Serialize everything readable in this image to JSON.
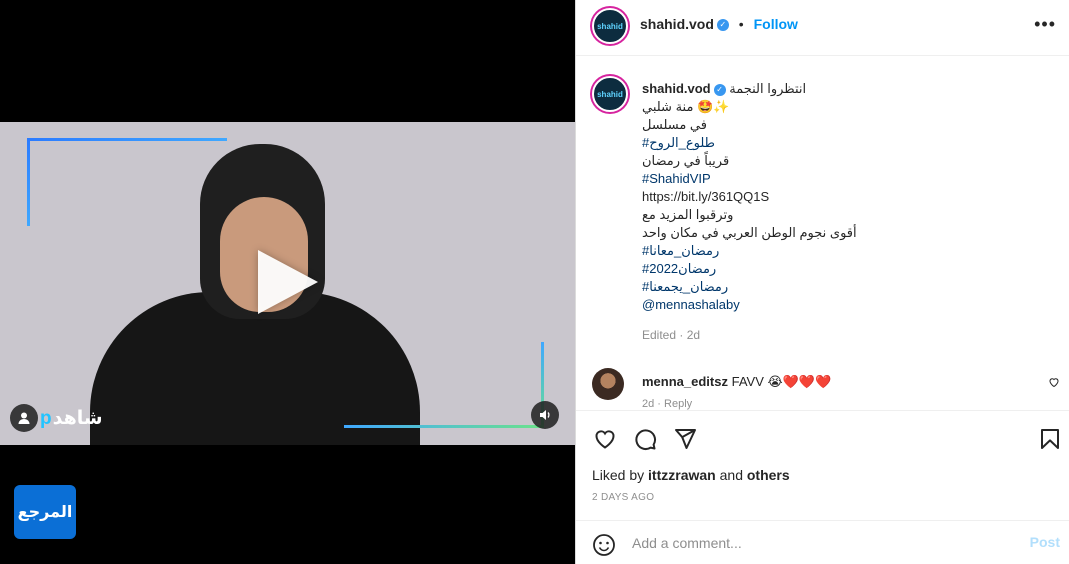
{
  "post": {
    "username": "shahid.vod",
    "follow_label": "Follow",
    "more_label": "•••"
  },
  "video": {
    "brand": "شاهد",
    "brand_suffix": "p"
  },
  "watermark": {
    "label": "المرجع"
  },
  "caption": {
    "username": "shahid.vod",
    "lines": [
      "انتظروا النجمة",
      "منة شلبي 🤩✨",
      "في مسلسل",
      "#طلوع_الروح",
      "قريباً في رمضان",
      "#ShahidVIP",
      "https://bit.ly/361QQ1S",
      "وترقبوا المزيد مع",
      "أقوى نجوم الوطن العربي في مكان واحد",
      "#رمضان_معانا",
      "#رمضان2022",
      "#رمضان_يجمعنا",
      "@mennashalaby"
    ],
    "edited": "Edited · 2d"
  },
  "comment": {
    "username": "menna_editsz",
    "text": "FAVV",
    "emoji": "😭",
    "hearts": "❤️❤️❤️",
    "time": "2d · Reply"
  },
  "engagement": {
    "liked_by_prefix": "Liked by",
    "liked_by_user": "ittzzrawan",
    "liked_by_and": "and",
    "liked_by_others": "others",
    "date": "2 DAYS AGO"
  },
  "composer": {
    "placeholder": "Add a comment...",
    "post_label": "Post"
  }
}
